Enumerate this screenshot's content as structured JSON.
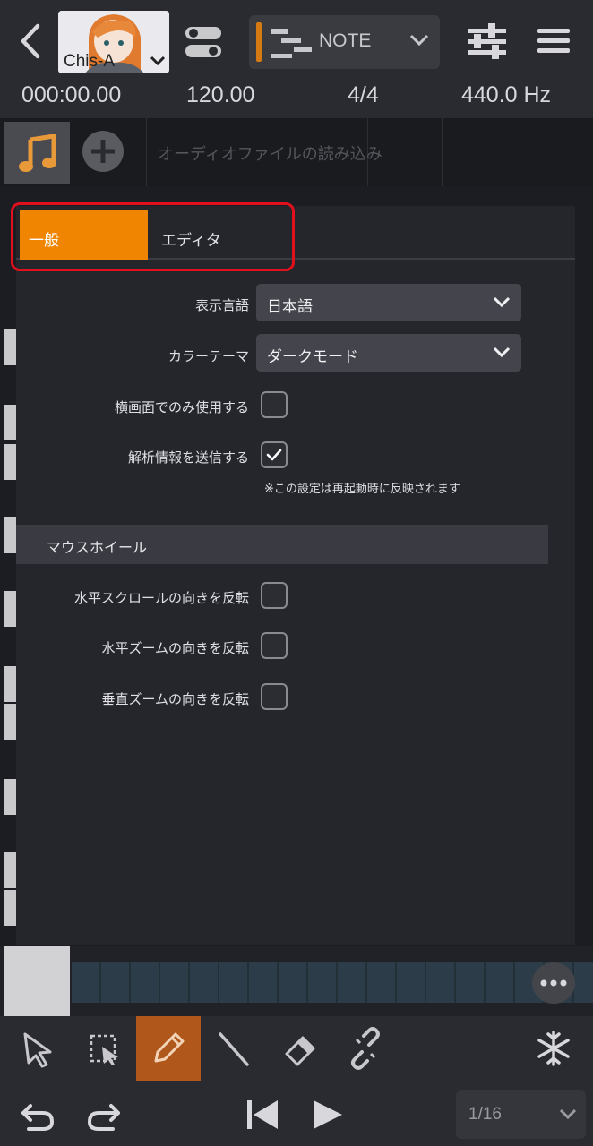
{
  "header": {
    "back_icon": "back-chevron-icon",
    "singer": {
      "name": "Chis-A",
      "avatar_icon": "singer-avatar-icon",
      "dropdown_icon": "chevron-down-icon"
    },
    "track_toggle_icon": "toggle-switch-icon",
    "mode_select": {
      "value": "NOTE",
      "icon": "note-mode-icon",
      "accent": "#d57a12"
    },
    "mixer_icon": "sliders-icon",
    "menu_icon": "hamburger-menu-icon"
  },
  "info": {
    "time": "000:00.00",
    "tempo": "120.00",
    "signature": "4/4",
    "pitch": "440.0 Hz"
  },
  "track": {
    "note_icon": "music-note-icon",
    "add_icon": "plus-circle-icon",
    "import_label": "オーディオファイルの読み込み"
  },
  "settings": {
    "tabs": [
      {
        "label": "一般",
        "active": true
      },
      {
        "label": "エディタ",
        "active": false
      }
    ],
    "language": {
      "label": "表示言語",
      "value": "日本語"
    },
    "theme": {
      "label": "カラーテーマ",
      "value": "ダークモード"
    },
    "landscape_only": {
      "label": "横画面でのみ使用する",
      "checked": false
    },
    "send_analytics": {
      "label": "解析情報を送信する",
      "checked": true
    },
    "restart_note": "※この設定は再起動時に反映されます",
    "mouse_wheel": {
      "title": "マウスホイール",
      "options": [
        {
          "label": "水平スクロールの向きを反転",
          "checked": false
        },
        {
          "label": "水平ズームの向きを反転",
          "checked": false
        },
        {
          "label": "垂直ズームの向きを反転",
          "checked": false
        }
      ]
    },
    "accent": "#ef8500",
    "highlight_color": "#e0101c"
  },
  "toolbar": {
    "tools": [
      "arrow-pointer-icon",
      "range-select-icon",
      "pencil-icon",
      "line-icon",
      "eraser-icon",
      "link-icon"
    ],
    "active_tool": "pencil-icon",
    "freeze_icon": "snowflake-icon",
    "undo_icon": "undo-icon",
    "redo_icon": "redo-icon",
    "rewind_icon": "skip-to-start-icon",
    "play_icon": "play-icon",
    "quantize": "1/16",
    "more_icon": "more-dots-icon"
  }
}
